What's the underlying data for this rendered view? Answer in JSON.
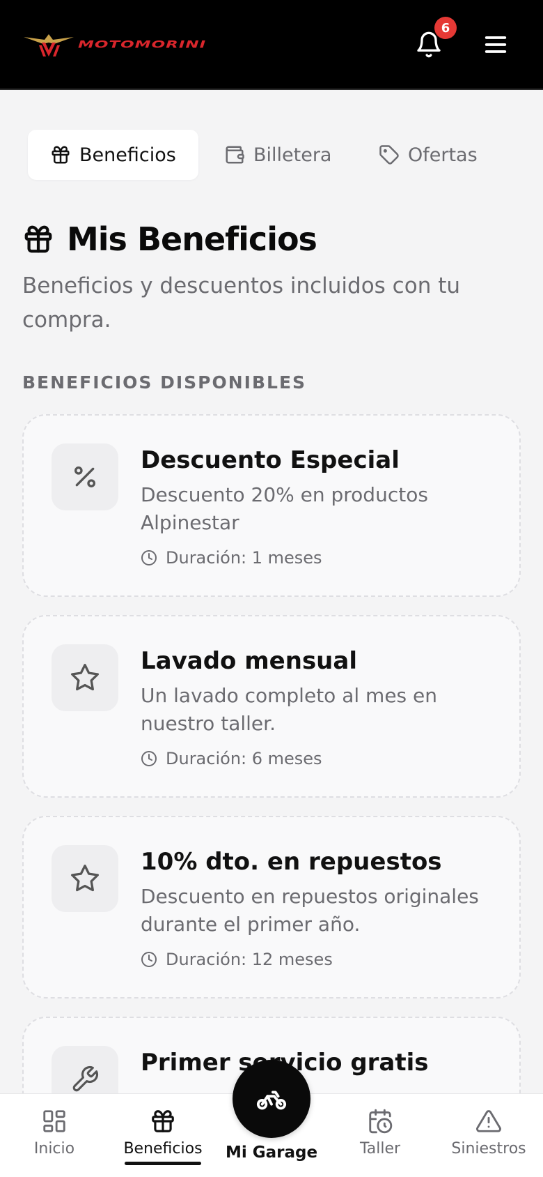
{
  "header": {
    "logo_text": "MOTOMORINI",
    "notification_count": "6",
    "brand_color": "#d9262c"
  },
  "tabs": [
    {
      "label": "Beneficios",
      "icon": "gift-icon",
      "active": true
    },
    {
      "label": "Billetera",
      "icon": "wallet-icon",
      "active": false
    },
    {
      "label": "Ofertas",
      "icon": "tag-icon",
      "active": false
    }
  ],
  "page": {
    "title": "Mis Beneficios",
    "subtitle": "Beneficios y descuentos incluidos con tu compra.",
    "section_label": "BENEFICIOS DISPONIBLES"
  },
  "benefits": [
    {
      "icon": "percent-icon",
      "title": "Descuento Especial",
      "description": "Descuento 20% en productos Alpinestar",
      "duration": "Duración: 1 meses"
    },
    {
      "icon": "star-icon",
      "title": "Lavado mensual",
      "description": "Un lavado completo al mes en nuestro taller.",
      "duration": "Duración: 6 meses"
    },
    {
      "icon": "star-icon",
      "title": "10% dto. en repuestos",
      "description": "Descuento en repuestos originales durante el primer año.",
      "duration": "Duración: 12 meses"
    },
    {
      "icon": "wrench-icon",
      "title": "Primer servicio gratis",
      "description": "",
      "duration": ""
    }
  ],
  "bottom_nav": {
    "items": [
      {
        "label": "Inicio",
        "icon": "dashboard-icon"
      },
      {
        "label": "Beneficios",
        "icon": "gift-icon",
        "active": true
      },
      {
        "label": "Taller",
        "icon": "calendar-clock-icon"
      },
      {
        "label": "Siniestros",
        "icon": "warning-icon"
      }
    ],
    "center_label": "Mi Garage",
    "center_icon": "motorcycle-icon"
  }
}
